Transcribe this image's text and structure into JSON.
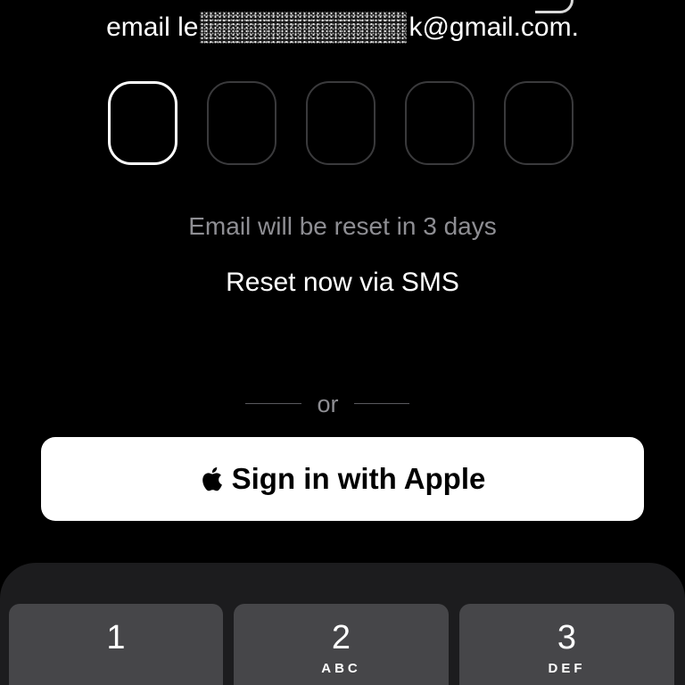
{
  "verification": {
    "email_prefix": "email le",
    "email_suffix": "k@gmail.com.",
    "code_length": 5,
    "active_index": 0
  },
  "info": {
    "reset_notice": "Email will be reset in 3 days",
    "reset_sms_link": "Reset now via SMS"
  },
  "divider": {
    "label": "or"
  },
  "apple_button": {
    "label": "Sign in with Apple",
    "icon": "apple-logo-icon"
  },
  "keypad": {
    "keys": [
      {
        "digit": "1",
        "letters": ""
      },
      {
        "digit": "2",
        "letters": "ABC"
      },
      {
        "digit": "3",
        "letters": "DEF"
      }
    ]
  },
  "colors": {
    "background": "#000000",
    "text_primary": "#ffffff",
    "text_secondary": "#8e8e93",
    "code_box_border": "#3a3a3c",
    "button_background": "#ffffff",
    "keypad_background": "#1c1c1e",
    "key_background": "#464649"
  }
}
